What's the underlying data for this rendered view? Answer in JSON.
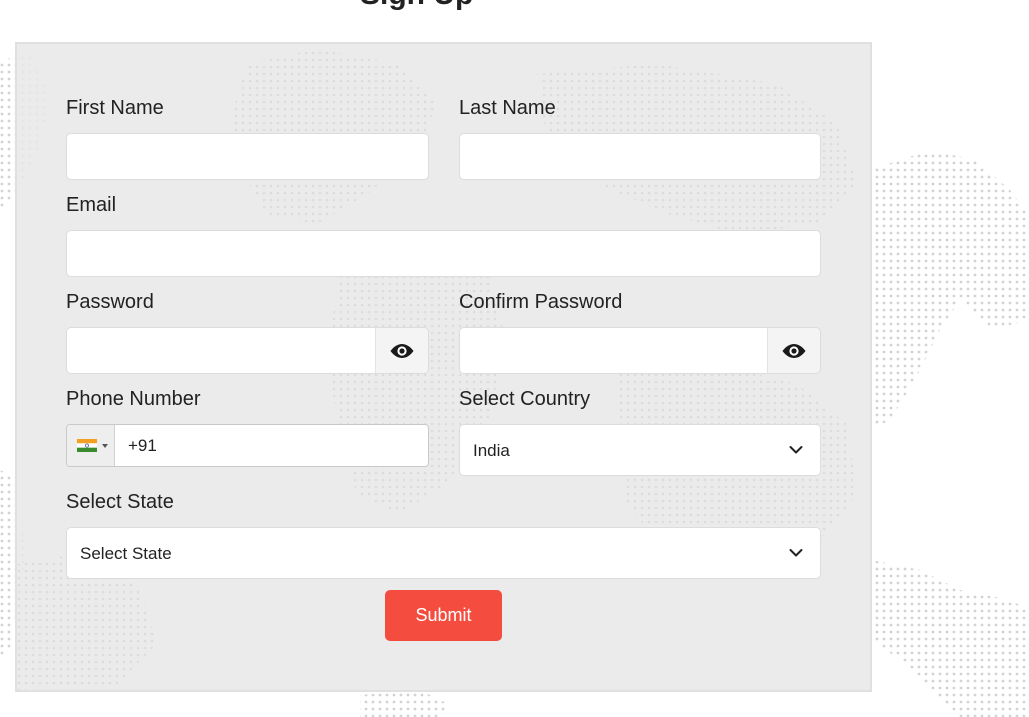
{
  "page": {
    "heading": "Sign Up"
  },
  "form": {
    "first_name": {
      "label": "First Name",
      "value": ""
    },
    "last_name": {
      "label": "Last Name",
      "value": ""
    },
    "email": {
      "label": "Email",
      "value": ""
    },
    "password": {
      "label": "Password",
      "value": "",
      "toggle_icon": "eye-icon"
    },
    "confirm_password": {
      "label": "Confirm Password",
      "value": "",
      "toggle_icon": "eye-icon"
    },
    "phone": {
      "label": "Phone Number",
      "country_flag": "india-flag-icon",
      "dial_code": "+91"
    },
    "country": {
      "label": "Select Country",
      "selected": "India"
    },
    "state": {
      "label": "Select State",
      "selected": "Select State"
    },
    "submit_label": "Submit"
  },
  "colors": {
    "accent": "#f44d3f",
    "card_background": "#e9e9e9",
    "input_border": "#dcdcdc"
  }
}
